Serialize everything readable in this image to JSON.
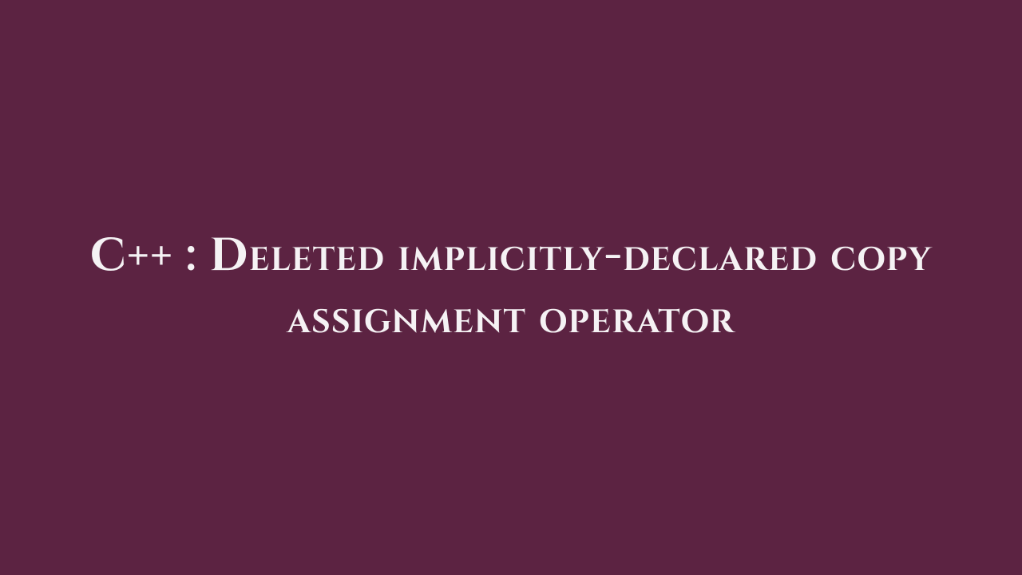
{
  "title_card": {
    "text": "C++ : Deleted implicitly-declared copy assignment operator"
  }
}
